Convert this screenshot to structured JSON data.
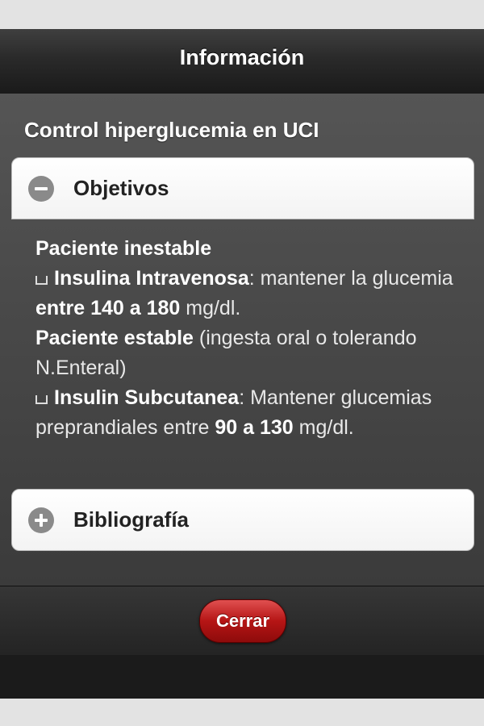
{
  "header": {
    "title": "Información"
  },
  "section": {
    "title": "Control hiperglucemia en UCI"
  },
  "collapsibles": [
    {
      "label": "Objetivos",
      "state": "expanded",
      "icon": "minus-icon"
    },
    {
      "label": "Bibliografía",
      "state": "collapsed",
      "icon": "plus-icon"
    }
  ],
  "objetivos": {
    "unstable_heading": "Paciente inestable",
    "iv_label": "Insulina Intravenosa",
    "iv_text_1": ": mantener la glucemia ",
    "iv_range": "entre 140 a 180",
    "iv_unit": " mg/dl.",
    "stable_heading": "Paciente estable",
    "stable_note": " (ingesta oral o tolerando N.Enteral)",
    "sc_label": "Insulin Subcutanea",
    "sc_text_1": ": Mantener glucemias preprandiales entre ",
    "sc_range": "90 a 130",
    "sc_unit": " mg/dl."
  },
  "footer": {
    "close_label": "Cerrar"
  },
  "colors": {
    "close_button": "#b51515",
    "header_bg": "#2a2a2a",
    "content_bg": "#4a4a4a"
  }
}
